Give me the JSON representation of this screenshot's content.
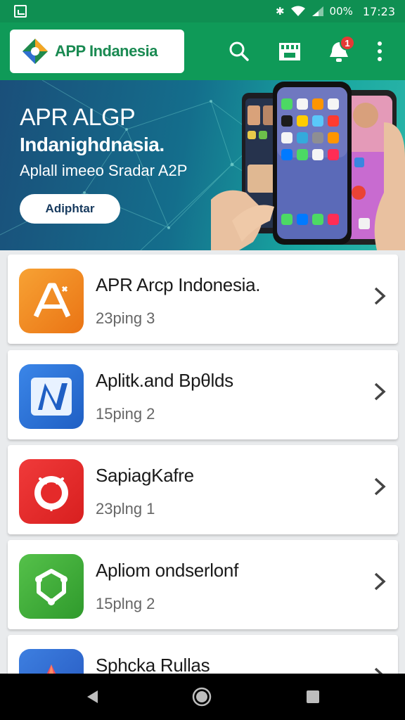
{
  "status_bar": {
    "battery_text": "00%",
    "time": "17:23",
    "icons": [
      "screenshot-icon",
      "bluetooth-icon",
      "wifi-icon",
      "signal-icon"
    ]
  },
  "app_bar": {
    "logo_text": "APP Indanesia",
    "notification_count": "1",
    "icons": [
      "search-icon",
      "store-icon",
      "notification-icon",
      "more-vert-icon"
    ],
    "colors": {
      "bar": "#0f9a58",
      "status": "#0f8f52",
      "badge": "#e53935"
    }
  },
  "banner": {
    "title": "APR ALGP",
    "subtitle": "Indanighdnasia.",
    "tagline": "Aplall imeeo Sradar A2P",
    "button_label": "Adiphtar"
  },
  "apps": [
    {
      "name": "APR Arcp Indonesia.",
      "meta": "23ping 3",
      "icon": "letter-a-icon",
      "color": "#f08a1c"
    },
    {
      "name": "Aplitk.and Bpθlds",
      "meta": "15ping 2",
      "icon": "letter-n-icon",
      "color": "#2a6fd6"
    },
    {
      "name": "SapiagKafre",
      "meta": "23plng 1",
      "icon": "red-badge-icon",
      "color": "#e52a2a"
    },
    {
      "name": "Apliom ondserlonf",
      "meta": "15plng 2",
      "icon": "green-shield-icon",
      "color": "#3fae3a"
    },
    {
      "name": "Sphcka Rullas",
      "meta": "",
      "icon": "triangle-icon",
      "color": "#2e6fd0"
    }
  ],
  "nav": {
    "icons": [
      "back-icon",
      "home-icon",
      "recents-icon"
    ]
  }
}
